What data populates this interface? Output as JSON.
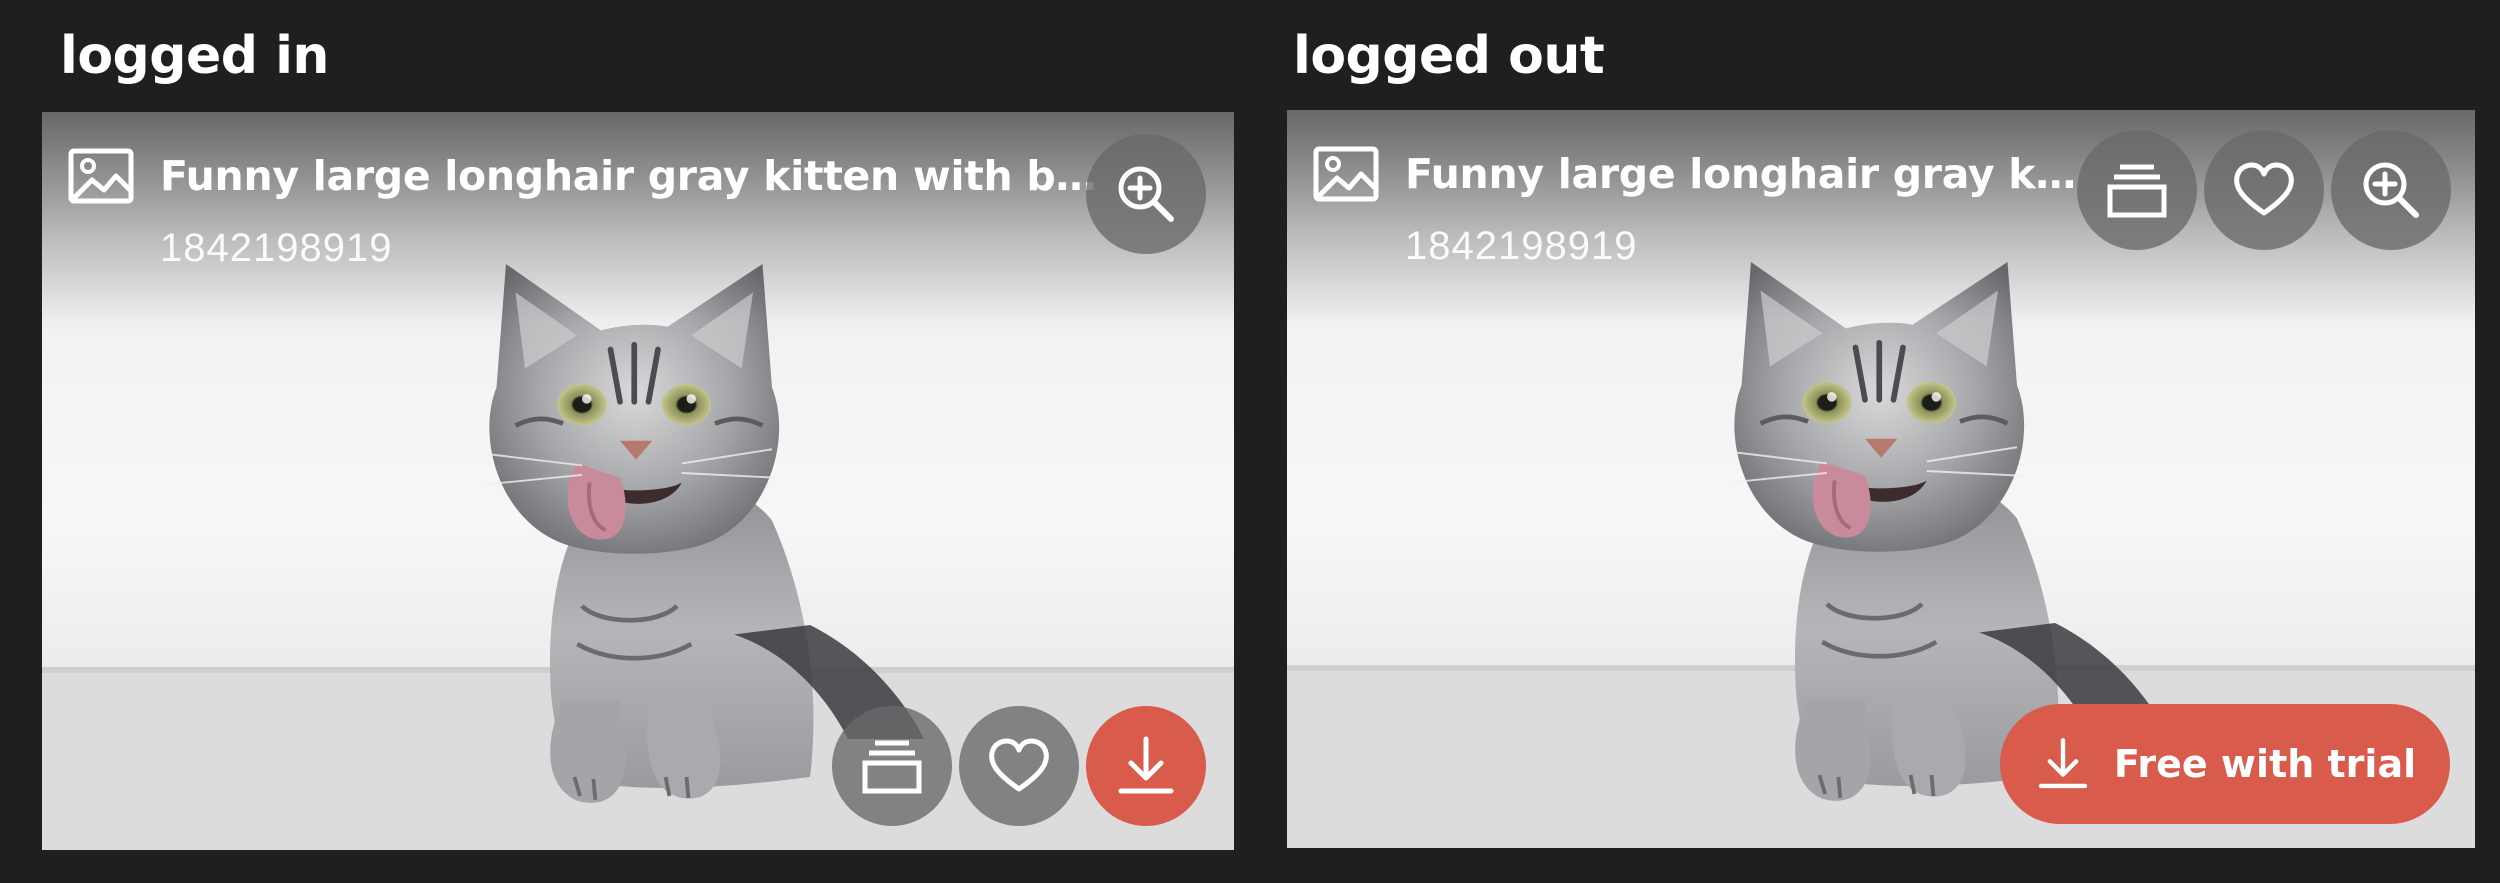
{
  "panels": [
    {
      "label": "logged in",
      "card": {
        "title": "Funny large longhair gray kitten with be...",
        "image_id": "1842198919",
        "actions": {
          "zoom": "zoom-in-icon",
          "collection": "collection-stack-icon",
          "favorite": "heart-icon",
          "download": "download-icon"
        }
      }
    },
    {
      "label": "logged out",
      "card": {
        "title": "Funny large longhair gray ki...",
        "image_id": "1842198919",
        "actions": {
          "zoom": "zoom-in-icon",
          "collection": "collection-stack-icon",
          "favorite": "heart-icon",
          "trial_label": "Free with trial"
        }
      }
    }
  ],
  "colors": {
    "background": "#1f1f1f",
    "accent": "#d95b4c",
    "overlay_button": "#69696c",
    "text": "#ffffff"
  }
}
